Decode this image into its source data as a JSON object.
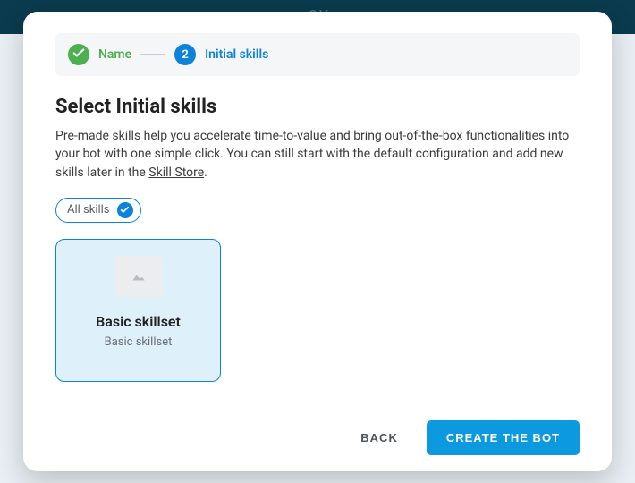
{
  "backdrop": {
    "brand_fragment": "CX"
  },
  "stepper": {
    "step1_label": "Name",
    "step2_number": "2",
    "step2_label": "Initial skills"
  },
  "heading": "Select Initial skills",
  "description_part1": "Pre-made skills help you accelerate time-to-value and bring out-of-the-box functionalities into your bot with one simple click. You can still start with the default configuration and add new skills later in the ",
  "description_link": "Skill Store",
  "description_part2": ".",
  "filter": {
    "all_label": "All skills"
  },
  "cards": [
    {
      "title": "Basic skillset",
      "subtitle": "Basic skillset"
    }
  ],
  "footer": {
    "back_label": "BACK",
    "create_label": "CREATE THE BOT"
  }
}
